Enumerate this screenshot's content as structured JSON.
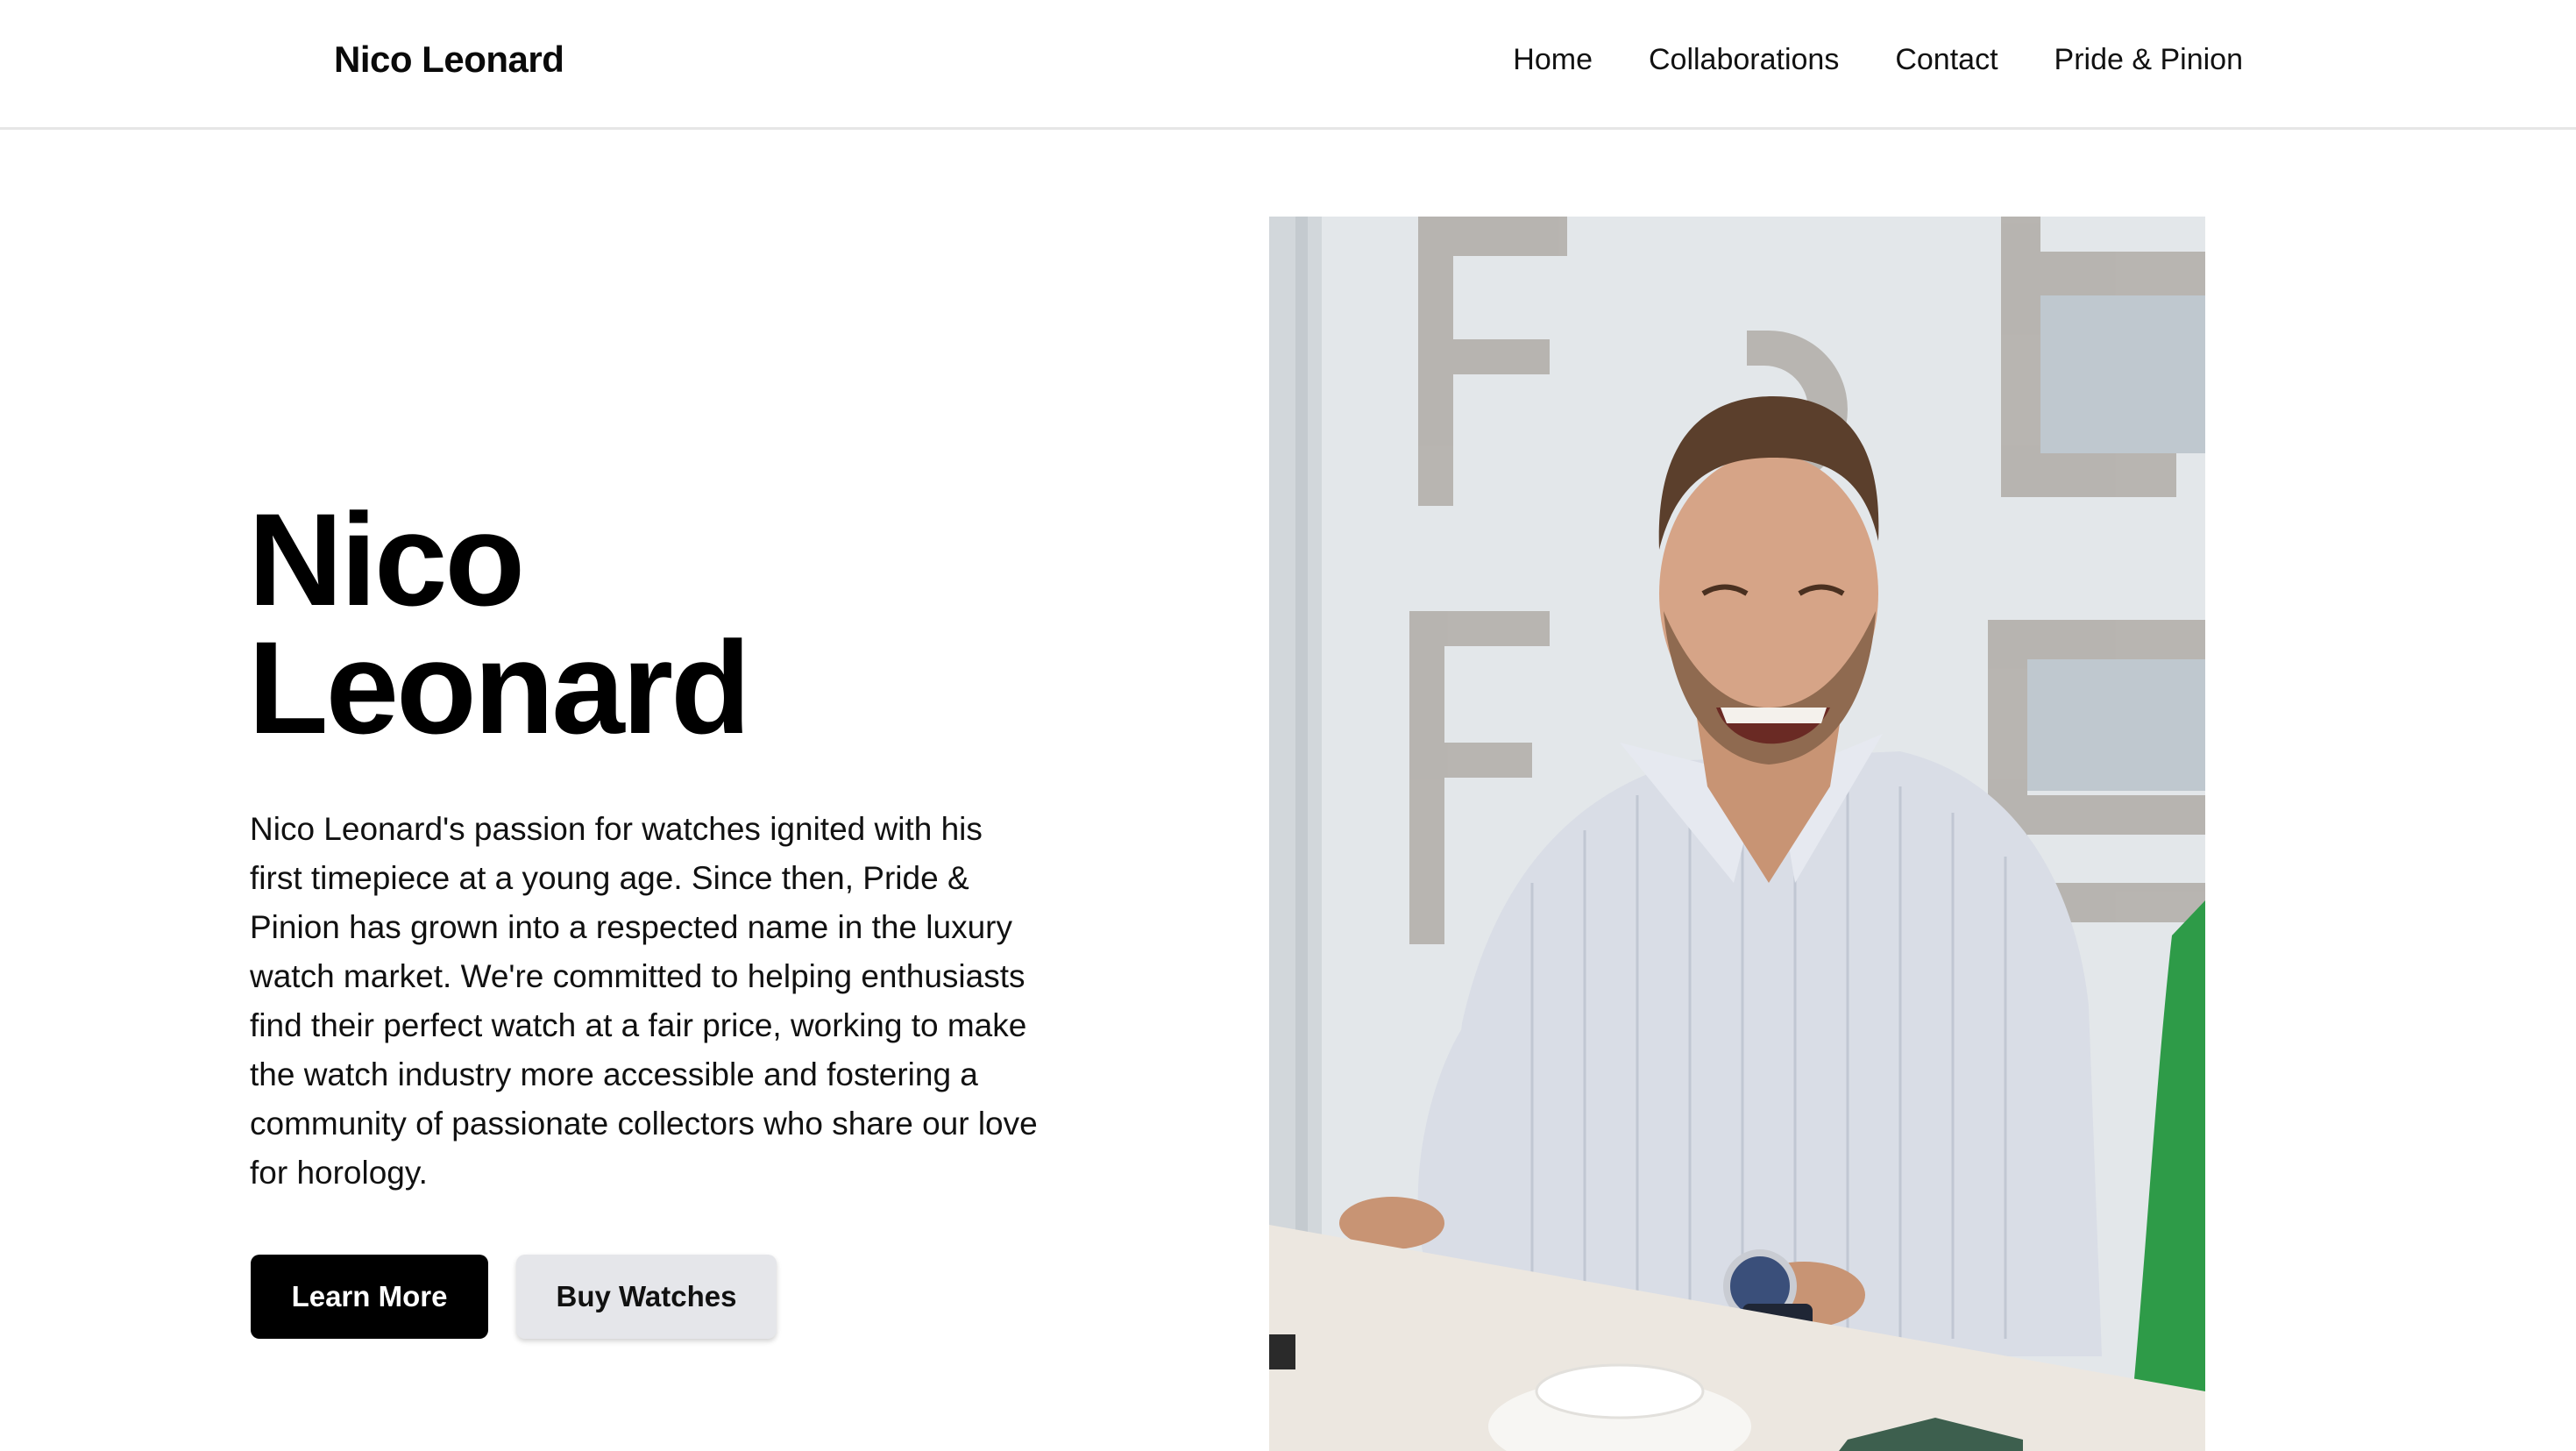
{
  "header": {
    "brand": "Nico Leonard",
    "nav": [
      {
        "label": "Home"
      },
      {
        "label": "Collaborations"
      },
      {
        "label": "Contact"
      },
      {
        "label": "Pride & Pinion"
      }
    ]
  },
  "hero": {
    "title_line1": "Nico",
    "title_line2": "Leonard",
    "description": "Nico Leonard's passion for watches ignited with his first timepiece at a young age. Since then, Pride & Pinion has grown into a respected name in the luxury watch market. We're committed to helping enthusiasts find their perfect watch at a fair price, working to make the watch industry more accessible and fostering a community of passionate collectors who share our love for horology.",
    "primary_button": "Learn More",
    "secondary_button": "Buy Watches"
  },
  "photo": {
    "subject": "portrait-photo",
    "colors": {
      "shirt": "#d9dde6",
      "wall": "#e4e8ea",
      "table": "#ece7e0",
      "green_sleeve": "#2e9b48"
    }
  },
  "colors": {
    "primary_button_bg": "#000000",
    "secondary_button_bg": "#e5e6ea",
    "header_border": "#e6e6e6"
  }
}
